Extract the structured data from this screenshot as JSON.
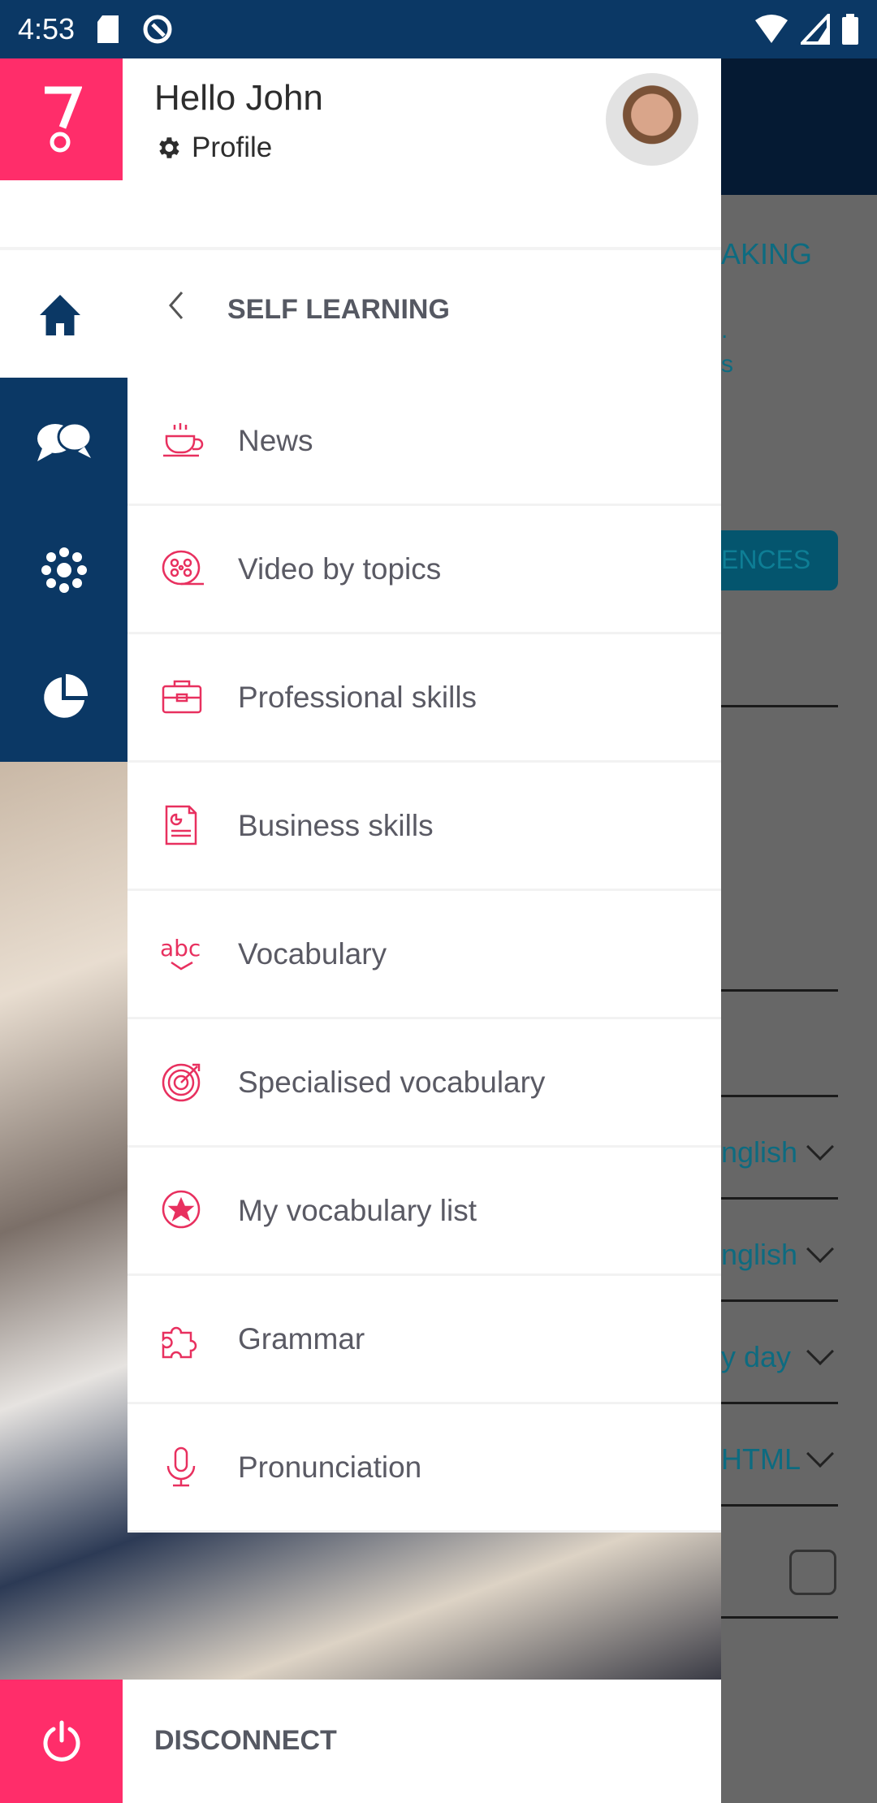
{
  "status_bar": {
    "time": "4:53"
  },
  "background_app": {
    "texts": [
      "AKING",
      ".",
      "s",
      "ENCES",
      "nglish",
      "nglish",
      "y day",
      "HTML"
    ]
  },
  "header": {
    "greeting": "Hello John",
    "profile_label": "Profile"
  },
  "nav": {
    "section_title": "SELF LEARNING"
  },
  "menu": {
    "items": [
      {
        "label": "News",
        "icon": "coffee-cup-icon"
      },
      {
        "label": "Video by topics",
        "icon": "film-reel-icon"
      },
      {
        "label": "Professional skills",
        "icon": "briefcase-icon"
      },
      {
        "label": "Business skills",
        "icon": "document-chart-icon"
      },
      {
        "label": "Vocabulary",
        "icon": "abc-check-icon"
      },
      {
        "label": "Specialised vocabulary",
        "icon": "target-icon"
      },
      {
        "label": "My vocabulary list",
        "icon": "star-circle-icon"
      },
      {
        "label": "Grammar",
        "icon": "puzzle-icon"
      },
      {
        "label": "Pronunciation",
        "icon": "microphone-icon"
      }
    ]
  },
  "footer": {
    "disconnect_label": "DISCONNECT"
  },
  "colors": {
    "accent": "#ff2d6a",
    "navy": "#0b3865",
    "text": "#5a5a64"
  }
}
